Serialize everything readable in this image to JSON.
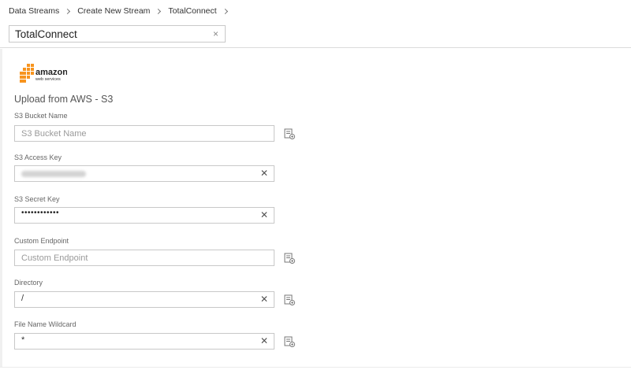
{
  "breadcrumb": [
    "Data Streams",
    "Create New Stream",
    "TotalConnect"
  ],
  "stream_name": {
    "value": "TotalConnect",
    "clear": "×"
  },
  "logo": {
    "brand": "amazon",
    "sub": "web services",
    "accent": "#f7941e"
  },
  "section_title": "Upload from AWS - S3",
  "fields": [
    {
      "label": "S3 Bucket Name",
      "value": "",
      "placeholder": "S3 Bucket Name",
      "clear": "",
      "has_icon": true
    },
    {
      "label": "S3 Access Key",
      "value": "",
      "placeholder": "",
      "masked": true,
      "clear": "✕",
      "has_icon": false
    },
    {
      "label": "S3 Secret Key",
      "value": "••••••••••••",
      "placeholder": "",
      "clear": "✕",
      "has_icon": false
    },
    {
      "label": "Custom Endpoint",
      "value": "",
      "placeholder": "Custom Endpoint",
      "clear": "",
      "has_icon": true
    },
    {
      "label": "Directory",
      "value": "/",
      "placeholder": "",
      "clear": "✕",
      "has_icon": true
    },
    {
      "label": "File Name Wildcard",
      "value": "*",
      "placeholder": "",
      "clear": "✕",
      "has_icon": true
    }
  ],
  "colors": {
    "border": "#c8c8c8",
    "label": "#666666",
    "divider": "#dcdcdc"
  }
}
